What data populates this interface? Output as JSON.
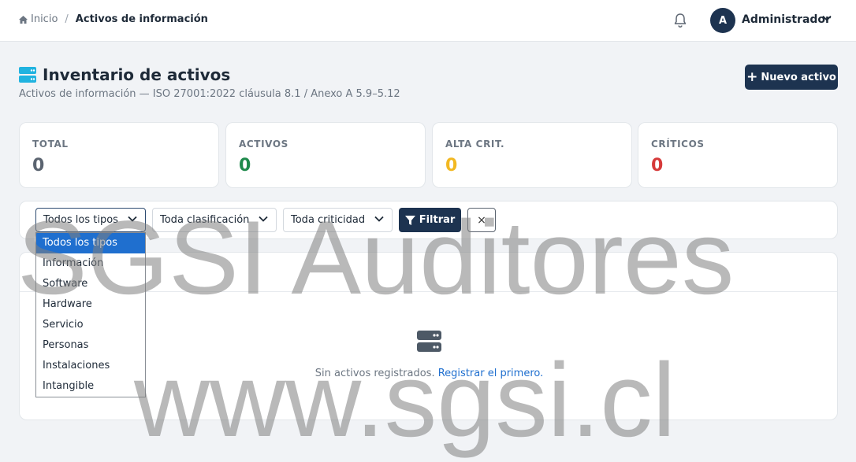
{
  "breadcrumb": {
    "home": "Inicio",
    "separator": "/",
    "current": "Activos de información"
  },
  "user": {
    "initial": "A",
    "name": "Administrador"
  },
  "page": {
    "title": "Inventario de activos",
    "subtitle": "Activos de información — ISO 27001:2022 cláusula 8.1 / Anexo A 5.9–5.12",
    "new_button": "Nuevo activo"
  },
  "stats": [
    {
      "label": "TOTAL",
      "value": "0",
      "color": "#5b6470"
    },
    {
      "label": "ACTIVOS",
      "value": "0",
      "color": "#1f8a4c"
    },
    {
      "label": "ALTA CRIT.",
      "value": "0",
      "color": "#f2b822"
    },
    {
      "label": "CRÍTICOS",
      "value": "0",
      "color": "#d63a3a"
    }
  ],
  "filters": {
    "type_selected": "Todos los tipos",
    "classification_selected": "Toda clasificación",
    "criticality_selected": "Toda criticidad",
    "filter_button": "Filtrar",
    "clear_button": "×",
    "type_options": [
      "Todos los tipos",
      "Información",
      "Software",
      "Hardware",
      "Servicio",
      "Personas",
      "Instalaciones",
      "Intangible"
    ]
  },
  "empty_state": {
    "text": "Sin activos registrados.",
    "link": "Registrar el primero."
  },
  "watermark": {
    "line1": "SGSI Auditores",
    "line2": "www.sgsi.cl"
  },
  "colors": {
    "primary": "#1d3350",
    "accent": "#1f6fcf",
    "title_icon": "#20b3e0"
  }
}
